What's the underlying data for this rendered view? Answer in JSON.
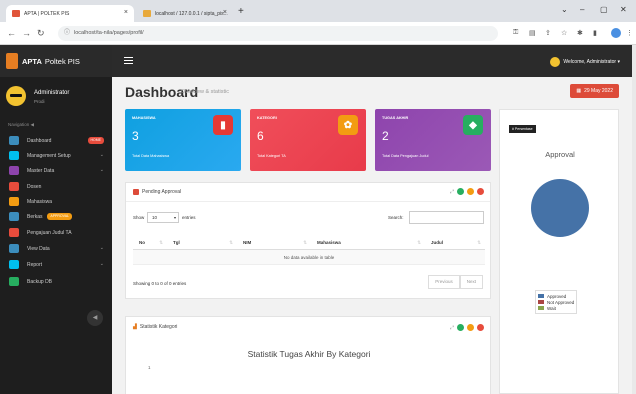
{
  "browser": {
    "tabs": [
      {
        "label": "APTA | POLTEK PIS",
        "close": "×"
      },
      {
        "label": "localhost / 127.0.0.1 / sipta_pis...",
        "close": "×"
      }
    ],
    "new_tab": "+",
    "url": "localhost/ta-nila/pages/profil/",
    "window_controls": [
      "⌄",
      "–",
      "▢",
      "✕"
    ]
  },
  "sidebar": {
    "brand_bold": "APTA",
    "brand_rest": "Poltek PIS",
    "user_name": "Administrator",
    "user_role": "Prodi",
    "nav_label": "Navigation ◀",
    "items": [
      {
        "label": "Dashboard",
        "badge": "HOME",
        "color": "#3c8dbc"
      },
      {
        "label": "Management Setup",
        "chev": "⌄",
        "color": "#00c0ef"
      },
      {
        "label": "Master Data",
        "chev": "⌄",
        "color": "#8e44ad"
      },
      {
        "label": "Dosen",
        "color": "#e74c3c"
      },
      {
        "label": "Mahasiswa",
        "color": "#f39c12"
      },
      {
        "label": "Berkas",
        "badge": "APPROVAL",
        "color": "#3c8dbc"
      },
      {
        "label": "Pengajuan Judul TA",
        "color": "#e74c3c"
      },
      {
        "label": "View Data",
        "chev": "⌄",
        "color": "#3c8dbc"
      },
      {
        "label": "Report",
        "chev": "⌄",
        "color": "#00c0ef"
      },
      {
        "label": "Backup DB",
        "color": "#27ae60"
      }
    ],
    "collapse_icon": "◀"
  },
  "topbar": {
    "welcome": "Welcome, Administrator ▾"
  },
  "page": {
    "title": "Dashboard",
    "subtitle": "Overview & statistic",
    "date": "29 May 2022"
  },
  "stats": [
    {
      "label": "MAHASISWA",
      "value": "3",
      "footer": "Total Data Mahasiswa",
      "icon": "▮"
    },
    {
      "label": "KATEGORI",
      "value": "6",
      "footer": "Total Kategori TA",
      "icon": "✿"
    },
    {
      "label": "TUGAS AKHIR",
      "value": "2",
      "footer": "Total Data Pengajuan Judul",
      "icon": "◆"
    }
  ],
  "pending": {
    "title": "Pending Approval",
    "expand": "⤢",
    "show": "Show",
    "entries_value": "10",
    "entries": "entries",
    "search": "Search:",
    "columns": [
      {
        "label": "No",
        "sort": "⇅"
      },
      {
        "label": "Tgl",
        "sort": "⇅"
      },
      {
        "label": "NIM",
        "sort": "⇅"
      },
      {
        "label": "Mahasiswa",
        "sort": "⇅"
      },
      {
        "label": "Judul",
        "sort": "⇅"
      }
    ],
    "empty": "No data available in table",
    "info": "Showing 0 to 0 of 0 entries",
    "previous": "Previous",
    "next": "Next"
  },
  "approval": {
    "label": "# Persentase",
    "title": "Approval",
    "legend": [
      {
        "label": "Approved",
        "color": "#4572a7"
      },
      {
        "label": "Not Approved",
        "color": "#aa4643"
      },
      {
        "label": "Wait",
        "color": "#89a54e"
      }
    ]
  },
  "kategori": {
    "title": "Statistik Kategori",
    "chart_title": "Statistik Tugas Akhir By Kategori",
    "y_tick": "1"
  },
  "colors": {
    "tool_green": "#27ae60",
    "tool_orange": "#f39c12",
    "tool_red": "#e74c3c"
  }
}
